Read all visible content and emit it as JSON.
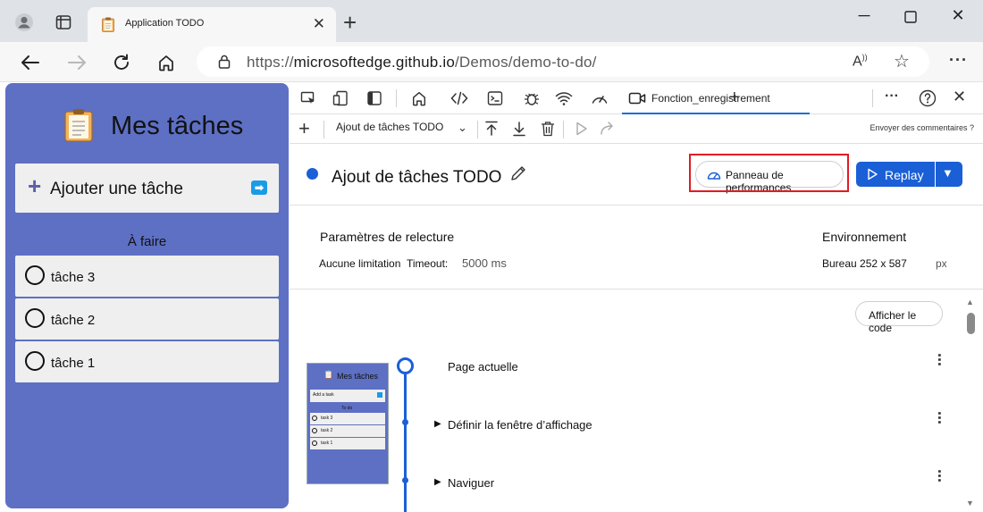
{
  "browser": {
    "tab_title": "Application TODO",
    "url_prefix": "https://",
    "url_host": "microsoftedge.github.io",
    "url_path": "/Demos/demo-to-do/",
    "read_aloud_label": "Aᴬ"
  },
  "app": {
    "title": "Mes tâches",
    "add_task_label": "Ajouter une tâche",
    "section_title": "À faire",
    "tasks": [
      {
        "label": "tâche 3"
      },
      {
        "label": "tâche 2"
      },
      {
        "label": "tâche 1"
      }
    ]
  },
  "devtools": {
    "active_tab_label": "Fonction_enregistrement",
    "recording_select": "Ajout de tâches TODO",
    "feedback_link": "Envoyer des commentaires ?",
    "recording_title": "Ajout de tâches TODO",
    "performance_button": "Panneau de performances",
    "replay_button": "Replay",
    "settings": {
      "replay_header": "Paramètres de relecture",
      "throttle": "Aucune limitation",
      "timeout_label": "Timeout:",
      "timeout_value": "5000 ms",
      "env_header": "Environnement",
      "env_value": "Bureau 252 x 587",
      "env_unit": "px"
    },
    "show_code_button": "Afficher le code",
    "steps": [
      {
        "label": "Page actuelle"
      },
      {
        "label": "Définir la fenêtre d’affichage"
      },
      {
        "label": "Naviguer"
      }
    ],
    "thumbnail": {
      "title": "Mes tâches",
      "add_label": "Add a task",
      "section": "To do",
      "tasks": [
        "task 3",
        "task 2",
        "task 1"
      ]
    }
  },
  "colors": {
    "app_bg": "#5e70c4",
    "accent_blue": "#1a5fd6",
    "highlight_red": "#e21b23"
  }
}
